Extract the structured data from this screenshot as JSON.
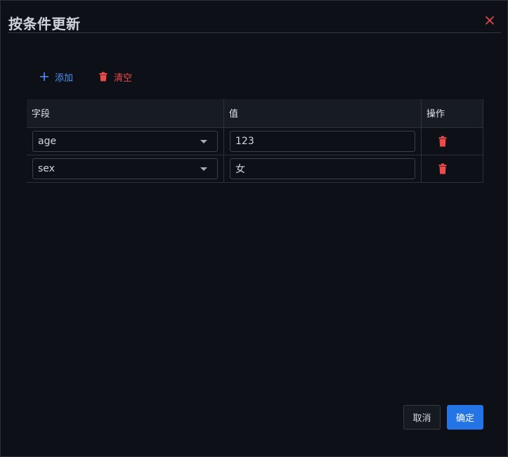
{
  "dialog": {
    "title": "按条件更新",
    "close_icon": "close-icon"
  },
  "toolbar": {
    "add_label": "添加",
    "add_icon": "plus-icon",
    "clear_label": "清空",
    "clear_icon": "trash-icon"
  },
  "table": {
    "headers": [
      "字段",
      "值",
      "操作"
    ],
    "rows": [
      {
        "field": "age",
        "value": "123"
      },
      {
        "field": "sex",
        "value": "女"
      }
    ]
  },
  "footer": {
    "cancel_label": "取消",
    "ok_label": "确定"
  },
  "colors": {
    "accent": "#2574e6",
    "danger": "#ea4b4b",
    "link": "#4b93f2",
    "background": "#0d1017"
  }
}
